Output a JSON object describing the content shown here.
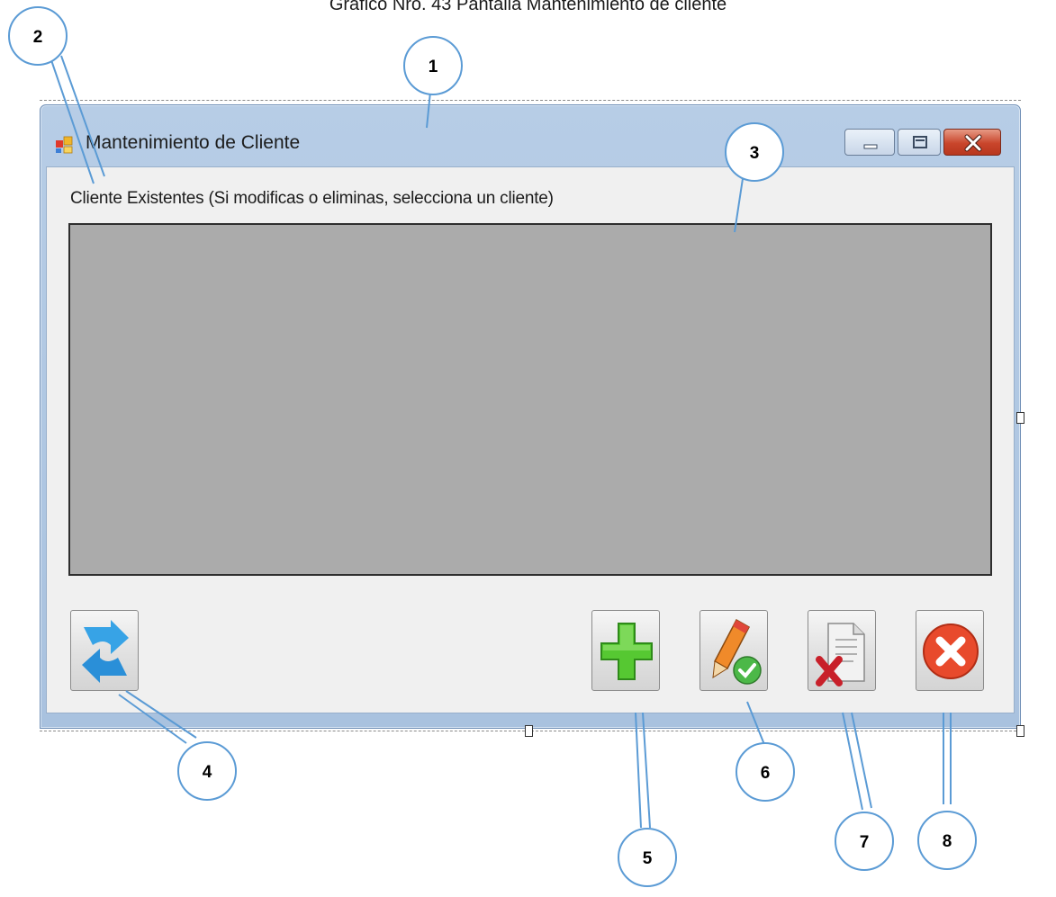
{
  "caption": "Grafico Nro. 43 Pantalla Mantenimiento de cliente",
  "window": {
    "title": "Mantenimiento de Cliente",
    "controls": [
      "minimize",
      "maximize",
      "close"
    ]
  },
  "form": {
    "label": "Cliente Existentes (Si modificas o eliminas, selecciona un cliente)"
  },
  "buttons": [
    {
      "name": "refresh",
      "icon": "refresh-arrows-icon"
    },
    {
      "name": "add",
      "icon": "plus-icon"
    },
    {
      "name": "edit",
      "icon": "pencil-check-icon"
    },
    {
      "name": "delete",
      "icon": "document-delete-icon"
    },
    {
      "name": "exit",
      "icon": "close-circle-icon"
    }
  ],
  "callouts": [
    "1",
    "2",
    "3",
    "4",
    "5",
    "6",
    "7",
    "8"
  ],
  "colors": {
    "titlebar": "#b7cde6",
    "grid_bg": "#ababab",
    "form_bg": "#f0f0f0",
    "callout_line": "#5b9bd5",
    "add_green": "#4cc52d",
    "exit_red": "#e8452a",
    "refresh_blue": "#2f9ae0"
  }
}
